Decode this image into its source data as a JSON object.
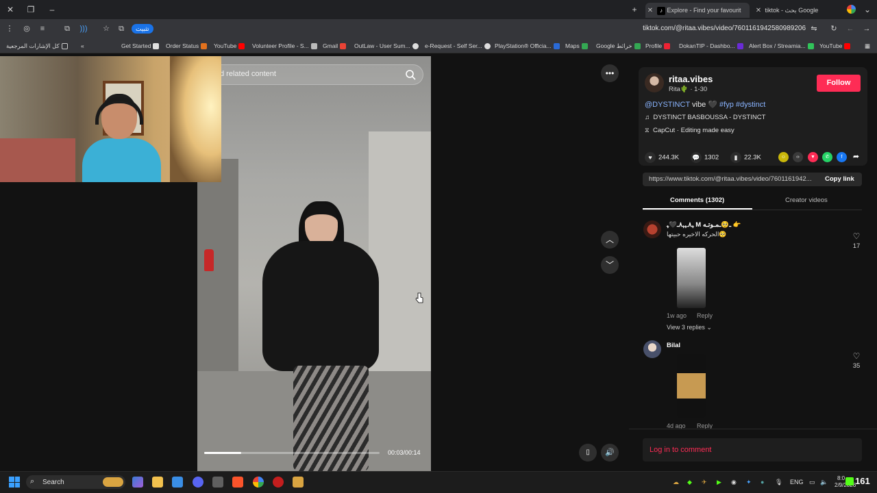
{
  "browser": {
    "tabs": [
      {
        "title": "Explore - Find your favourit",
        "active": true
      },
      {
        "title": "tiktok - بحث Google",
        "active": false
      }
    ],
    "install_label": "تثبيت",
    "url": "tiktok.com/@ritaa.vibes/video/7601161942580989206"
  },
  "bookmarks": [
    "كل الإشارات المرجعية",
    "Get Started",
    "Order Status",
    "YouTube",
    "Volunteer Profile - S...",
    "Gmail",
    "OutLaw - User Sum...",
    "e-Request - Self Ser...",
    "PlayStation® Officia...",
    "Maps",
    "Google خرائط",
    "Profile",
    "DokanTIP - Dashbo...",
    "Alert Box / Streamia...",
    "YouTube"
  ],
  "video": {
    "search_placeholder": "d related content",
    "time": "00:03/00:14",
    "progress": 0.21
  },
  "post": {
    "username": "ritaa.vibes",
    "nickname": "Rita🌵 · 1-30",
    "follow_label": "Follow",
    "caption_mention": "@DYSTINCT",
    "caption_word": " vibe 🖤 ",
    "caption_tags": "#fyp #dystinct",
    "music": "DYSTINCT BASBOUSSA - DYSTINCT",
    "capcut": "CapCut · Editing made easy",
    "likes": "244.3K",
    "comments_count": "1302",
    "saves": "22.3K",
    "link": "https://www.tiktok.com/@ritaa.vibes/video/7601161942...",
    "copy_link": "Copy link",
    "tab_comments": "Comments (1302)",
    "tab_creator": "Creator videos"
  },
  "comments": [
    {
      "name": "ﮩ٨ـﮩﮩ٨ـ🖤ﮩ M ـ🥺ـمـوتـه 👉",
      "text": "الحركه الاخيره حبيتها🥺",
      "time": "1w ago",
      "reply": "Reply",
      "likes": "17",
      "view_replies": "View 3 replies"
    },
    {
      "name": "Bilal",
      "text": "",
      "time": "4d ago",
      "reply": "Reply",
      "likes": "35"
    }
  ],
  "login_label": "Log in to comment",
  "taskbar": {
    "search_label": "Search",
    "lang": "ENG",
    "time": "8:0",
    "date": "2/9/2026",
    "counter": "161"
  }
}
